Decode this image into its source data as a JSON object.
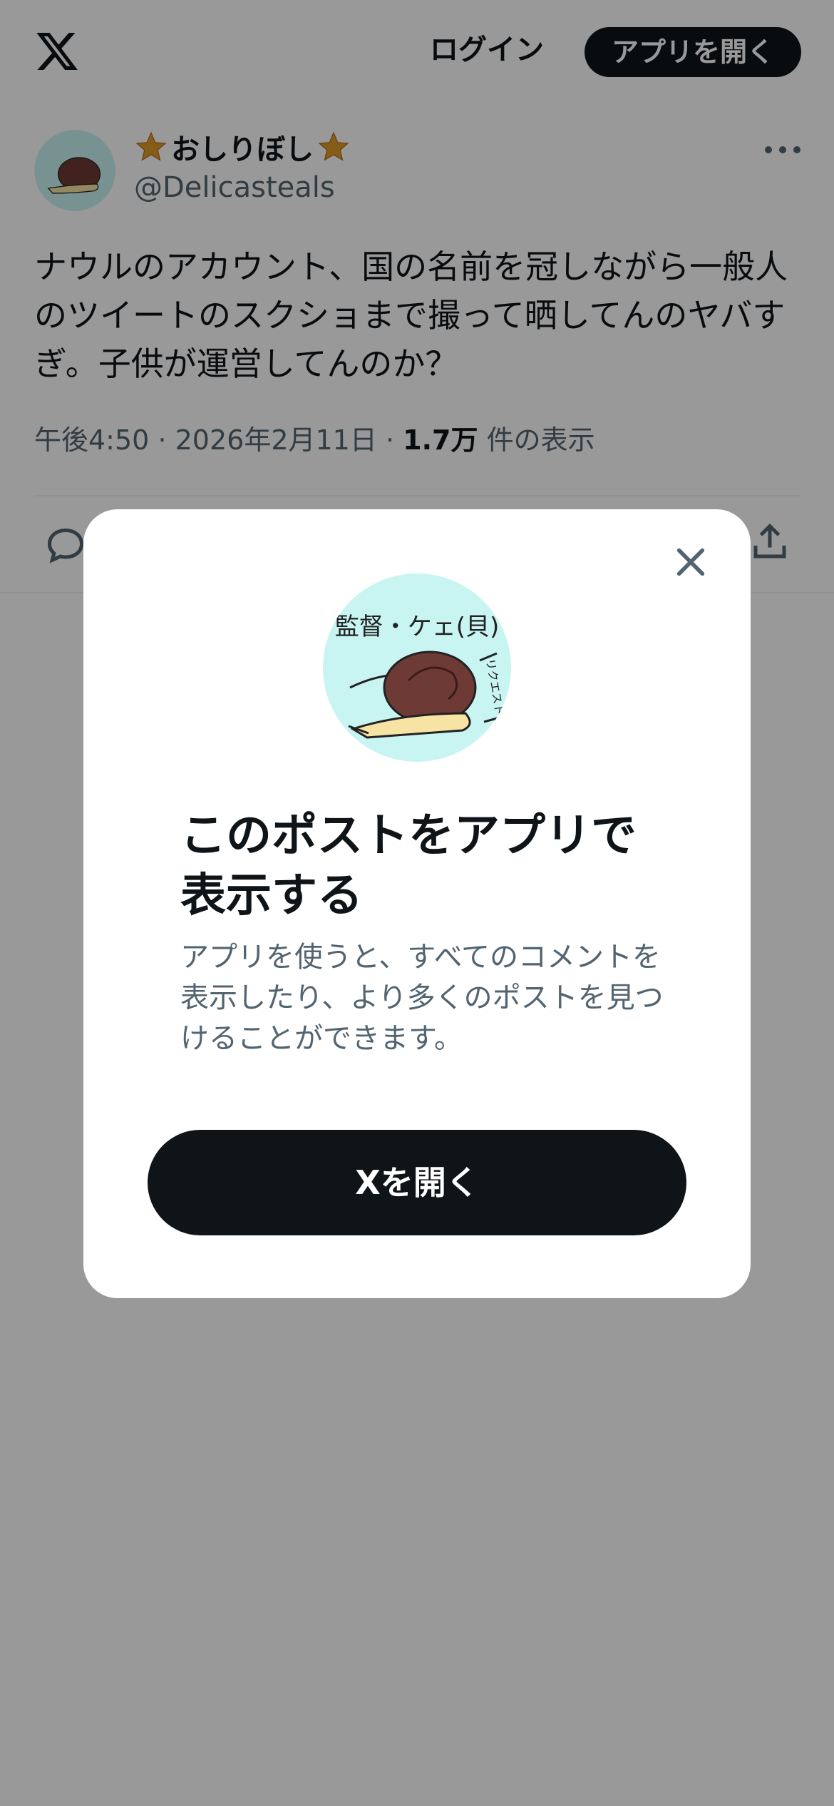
{
  "header": {
    "logo_icon": "x-logo-icon",
    "login_label": "ログイン",
    "open_app_label": "アプリを開く"
  },
  "post": {
    "display_name": "おしりぼし",
    "name_decoration_icon": "star-icon",
    "handle": "@Delicasteals",
    "text": "ナウルのアカウント、国の名前を冠しながら一般人のツイートのスクショまで撮って晒してんのヤバすぎ。子供が運営してんのか？",
    "time": "午後4:50",
    "separator": "·",
    "date": "2026年2月11日",
    "views_count": "1.7万",
    "views_label": "件の表示",
    "actions": [
      "reply-icon",
      "share-icon"
    ]
  },
  "avatar": {
    "caption": "監督・ケェ(貝)",
    "side_text": "リクエスト"
  },
  "modal": {
    "title": "このポストをアプリで表示する",
    "description": "アプリを使うと、すべてのコメントを表示したり、より多くのポストを見つけることができます。",
    "button_label": "Xを開く",
    "close_icon": "close-icon"
  },
  "colors": {
    "primary_text": "#0f1419",
    "secondary_text": "#536471",
    "button_dark": "#0f1419",
    "avatar_bg": "#c8f4f2",
    "overlay": "rgba(0,0,0,0.4)"
  }
}
